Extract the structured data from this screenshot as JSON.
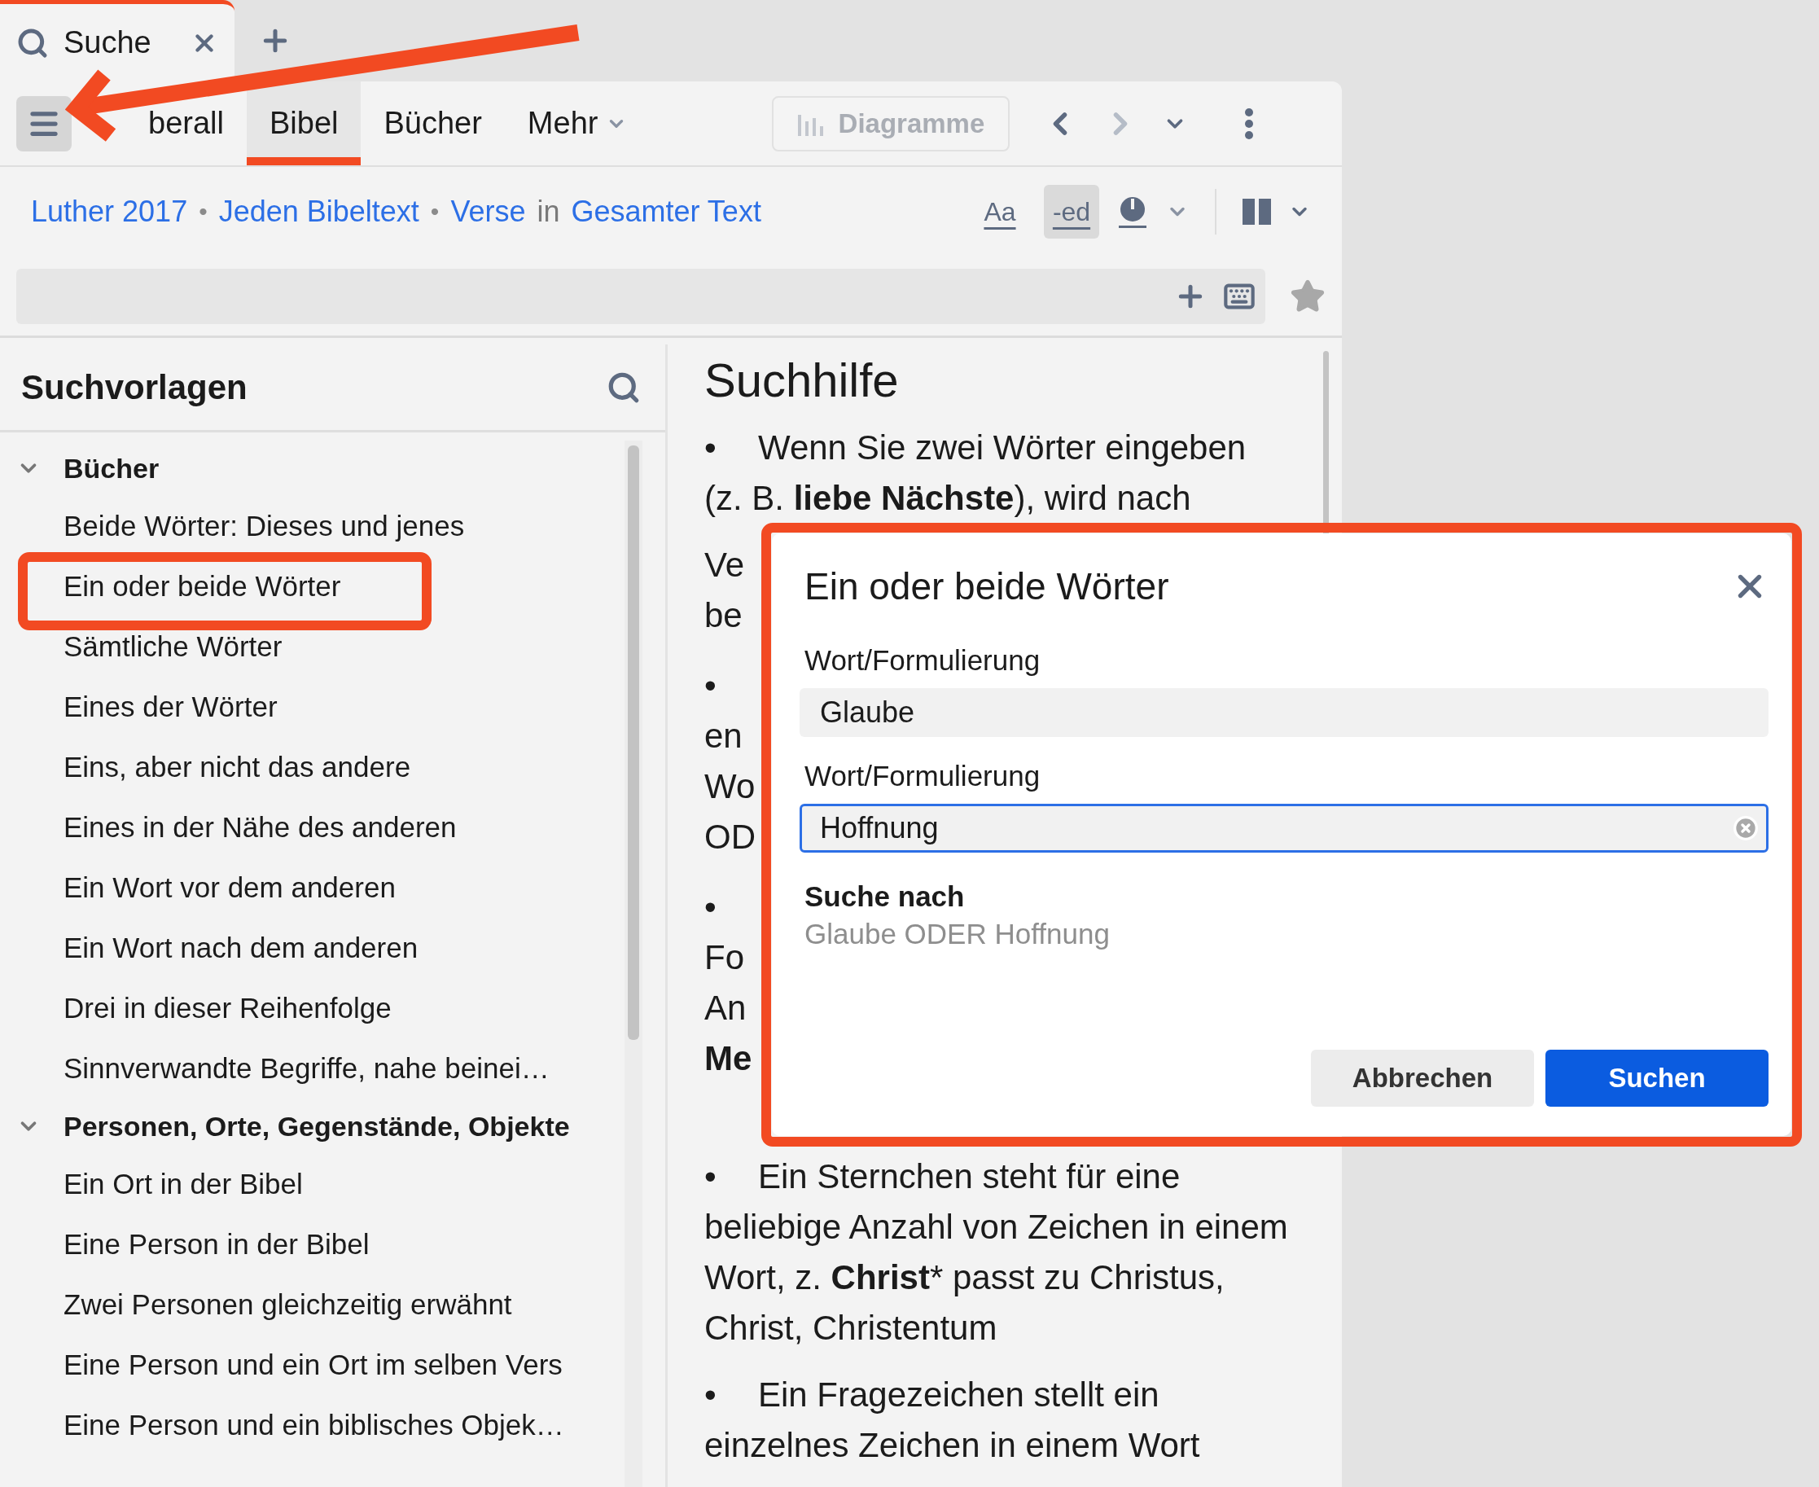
{
  "tab_strip": {
    "tabs": [
      {
        "label": "Suche",
        "selected": true
      }
    ]
  },
  "toolbar": {
    "tabs": [
      {
        "label": "berall",
        "selected": false,
        "dropdown": false
      },
      {
        "label": "Bibel",
        "selected": true,
        "dropdown": false
      },
      {
        "label": "Bücher",
        "selected": false,
        "dropdown": false
      },
      {
        "label": "Mehr",
        "selected": false,
        "dropdown": true
      }
    ],
    "chart_button": {
      "label": "Diagramme",
      "disabled": true
    },
    "back_disabled": false,
    "forward_disabled": true
  },
  "scope": {
    "items": [
      {
        "kind": "link",
        "text": "Luther 2017"
      },
      {
        "kind": "separator",
        "text": "•"
      },
      {
        "kind": "link",
        "text": "Jeden Bibeltext"
      },
      {
        "kind": "separator",
        "text": "•"
      },
      {
        "kind": "link",
        "text": "Verse"
      },
      {
        "kind": "plain",
        "text": "in"
      },
      {
        "kind": "link",
        "text": "Gesamter Text"
      }
    ],
    "toggles": [
      {
        "label": "Aa",
        "selected": false
      },
      {
        "label": "-ed",
        "selected": true
      }
    ]
  },
  "templates": {
    "title": "Suchvorlagen",
    "groups": [
      {
        "label": "Bücher",
        "expanded": true,
        "children": [
          {
            "label": "Beide Wörter: Dieses und jenes"
          },
          {
            "label": "Ein oder beide Wörter"
          },
          {
            "label": "Sämtliche Wörter"
          },
          {
            "label": "Eines der Wörter"
          },
          {
            "label": "Eins, aber nicht das andere"
          },
          {
            "label": "Eines in der Nähe des anderen"
          },
          {
            "label": "Ein Wort vor dem anderen"
          },
          {
            "label": "Ein Wort nach dem anderen"
          },
          {
            "label": "Drei in dieser Reihenfolge"
          },
          {
            "label": "Sinnverwandte Begriffe, nahe beinei…"
          }
        ]
      },
      {
        "label": "Personen, Orte, Gegenstände, Objekte",
        "expanded": true,
        "children": [
          {
            "label": "Ein Ort in der Bibel"
          },
          {
            "label": "Eine Person in der Bibel"
          },
          {
            "label": "Zwei Personen gleichzeitig erwähnt"
          },
          {
            "label": "Eine Person und ein Ort im selben Vers"
          },
          {
            "label": "Eine Person und ein biblisches Objek…"
          }
        ]
      }
    ]
  },
  "help": {
    "title": "Suchhilfe",
    "blocks": [
      {
        "kind": "paragraph",
        "bullet": "•",
        "parts": [
          {
            "text": "Wenn Sie zwei Wörter eingeben (z. B. ",
            "bold": false
          },
          {
            "text": "liebe Nächste",
            "bold": true
          },
          {
            "text": "), wird nach",
            "bold": false
          }
        ]
      },
      {
        "kind": "fragment",
        "text": "Ve",
        "bold": false
      },
      {
        "kind": "fragment",
        "text": "be",
        "bold": false
      },
      {
        "kind": "fragment",
        "text": "•",
        "bold": false
      },
      {
        "kind": "fragment",
        "text": "en",
        "bold": false
      },
      {
        "kind": "fragment",
        "text": "Wo",
        "bold": false
      },
      {
        "kind": "fragment",
        "text": "OD",
        "bold": false
      },
      {
        "kind": "fragment",
        "text": "•",
        "bold": false
      },
      {
        "kind": "fragment",
        "text": "Fo",
        "bold": false
      },
      {
        "kind": "fragment",
        "text": "An",
        "bold": false
      },
      {
        "kind": "fragment",
        "text": "Me",
        "bold": true
      },
      {
        "kind": "paragraph",
        "bullet": "•",
        "parts": [
          {
            "text": "Ein Sternchen steht für eine beliebige Anzahl von Zeichen in einem Wort, z. ",
            "bold": false
          },
          {
            "text": "Christ",
            "bold": true
          },
          {
            "text": "* passt zu Christus, Christ, Christentum",
            "bold": false
          }
        ]
      },
      {
        "kind": "paragraph",
        "bullet": "•",
        "parts": [
          {
            "text": "Ein Fragezeichen stellt ein einzelnes Zeichen in einem Wort",
            "bold": false
          }
        ]
      }
    ]
  },
  "dialog": {
    "title": "Ein oder beide Wörter",
    "fields": [
      {
        "label": "Wort/Formulierung",
        "value": "Glaube",
        "focused": false
      },
      {
        "label": "Wort/Formulierung",
        "value": "Hoffnung",
        "focused": true
      }
    ],
    "summary_label": "Suche nach",
    "summary": "Glaube ODER Hoffnung",
    "buttons": [
      {
        "label": "Abbrechen",
        "kind": "secondary"
      },
      {
        "label": "Suchen",
        "kind": "primary"
      }
    ]
  }
}
